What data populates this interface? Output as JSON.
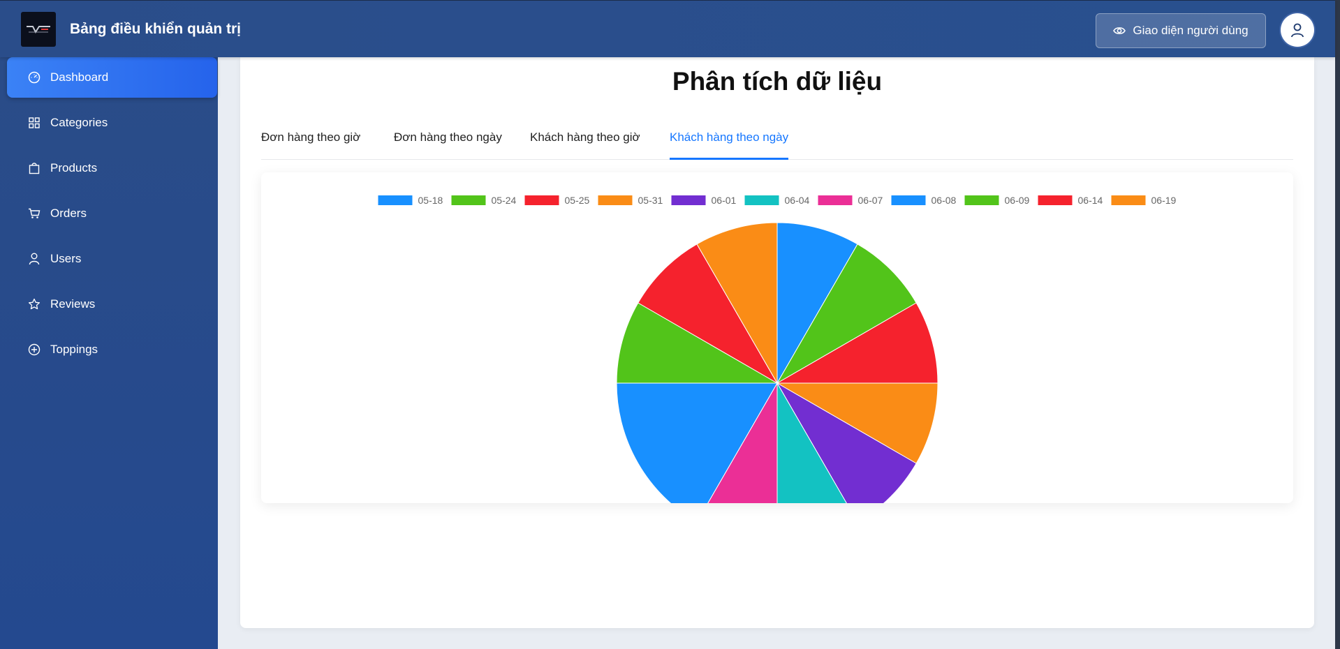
{
  "header": {
    "title": "Bảng điều khiển quản trị",
    "user_view_label": "Giao diện người dùng"
  },
  "sidebar": {
    "items": [
      {
        "label": "Dashboard",
        "icon": "dashboard-icon",
        "active": true
      },
      {
        "label": "Categories",
        "icon": "grid-icon",
        "active": false
      },
      {
        "label": "Products",
        "icon": "shopping-bag-icon",
        "active": false
      },
      {
        "label": "Orders",
        "icon": "cart-icon",
        "active": false
      },
      {
        "label": "Users",
        "icon": "user-icon",
        "active": false
      },
      {
        "label": "Reviews",
        "icon": "star-icon",
        "active": false
      },
      {
        "label": "Toppings",
        "icon": "plus-circle-icon",
        "active": false
      }
    ]
  },
  "main": {
    "title": "Phân tích dữ liệu",
    "tabs": [
      {
        "label": "Đơn hàng theo giờ",
        "active": false
      },
      {
        "label": "Đơn hàng theo ngày",
        "active": false
      },
      {
        "label": "Khách hàng theo giờ",
        "active": false
      },
      {
        "label": "Khách hàng theo ngày",
        "active": true
      }
    ]
  },
  "colors": {
    "accent": "#1677ff",
    "active_nav": "#3b82f6"
  },
  "chart_data": {
    "type": "pie",
    "title": "",
    "legend_position": "top",
    "categories": [
      "05-18",
      "05-24",
      "05-25",
      "05-31",
      "06-01",
      "06-04",
      "06-07",
      "06-08",
      "06-09",
      "06-14",
      "06-19"
    ],
    "values": [
      1,
      1,
      1,
      1,
      1,
      1,
      1,
      2,
      1,
      1,
      1
    ],
    "colors": [
      "#1890ff",
      "#52c41a",
      "#f5222d",
      "#fa8c16",
      "#722ed1",
      "#13c2c2",
      "#eb2f96",
      "#1890ff",
      "#52c41a",
      "#f5222d",
      "#fa8c16"
    ]
  }
}
